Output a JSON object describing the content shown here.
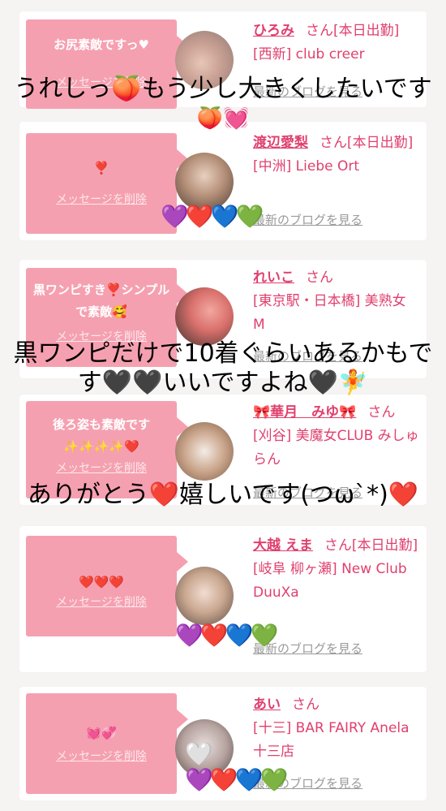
{
  "cards": [
    {
      "message": "お尻素敵ですっ♥",
      "delete_label": "メッセージを削除",
      "name": "ひろみ",
      "suffix": "さん[本日出勤]",
      "shop": "[西新] club creer",
      "blog": "最新のブログを見る"
    },
    {
      "message": "❣️",
      "delete_label": "メッセージを削除",
      "name": "渡辺愛梨",
      "suffix": "さん[本日出勤]",
      "shop": "[中洲] Liebe Ort",
      "blog": "最新のブログを見る"
    },
    {
      "message": "黒ワンピすき❣️シンプルで素敵🥰",
      "delete_label": "メッセージを削除",
      "name": "れいこ",
      "suffix": "さん",
      "shop": "[東京駅・日本橋] 美熟女 M",
      "blog": "最新のブログを見る"
    },
    {
      "message": "後ろ姿も素敵です✨✨✨✨❤️",
      "delete_label": "メッセージを削除",
      "name": "🎀華月　みゆ🎀",
      "suffix": "さん",
      "shop": "[刈谷] 美魔女CLUB みしゅらん",
      "blog": "最新のブログを見る"
    },
    {
      "message": "❤️❤️❤️",
      "delete_label": "メッセージを削除",
      "name": "大越 えま",
      "suffix": "さん[本日出勤]",
      "shop": "[岐阜 柳ヶ瀬] New Club DuuXa",
      "blog": "最新のブログを見る"
    },
    {
      "message": "💓💞",
      "delete_label": "メッセージを削除",
      "name": "あい",
      "suffix": "さん",
      "shop": "[十三] BAR FAIRY Anela 十三店",
      "blog": "最新のブログを見る"
    }
  ],
  "overlays": {
    "o1_line1": "うれしっ🍑もう少し大きくしたいです",
    "o1_line2": "🍑💓",
    "o2_line1": "黒ワンピだけで10着ぐらいあるかもで",
    "o2_line2": "す🖤🖤いいですよね🖤🧚",
    "o3_line1": "ありがとう❤️嬉しいです(つω`*)❤️"
  },
  "hearts": "💜❤️💙💚",
  "hearts_small": "🤍",
  "colors": {
    "accent": "#e0406e",
    "bubble": "#f5a0b0",
    "background": "#f6f3f3"
  }
}
